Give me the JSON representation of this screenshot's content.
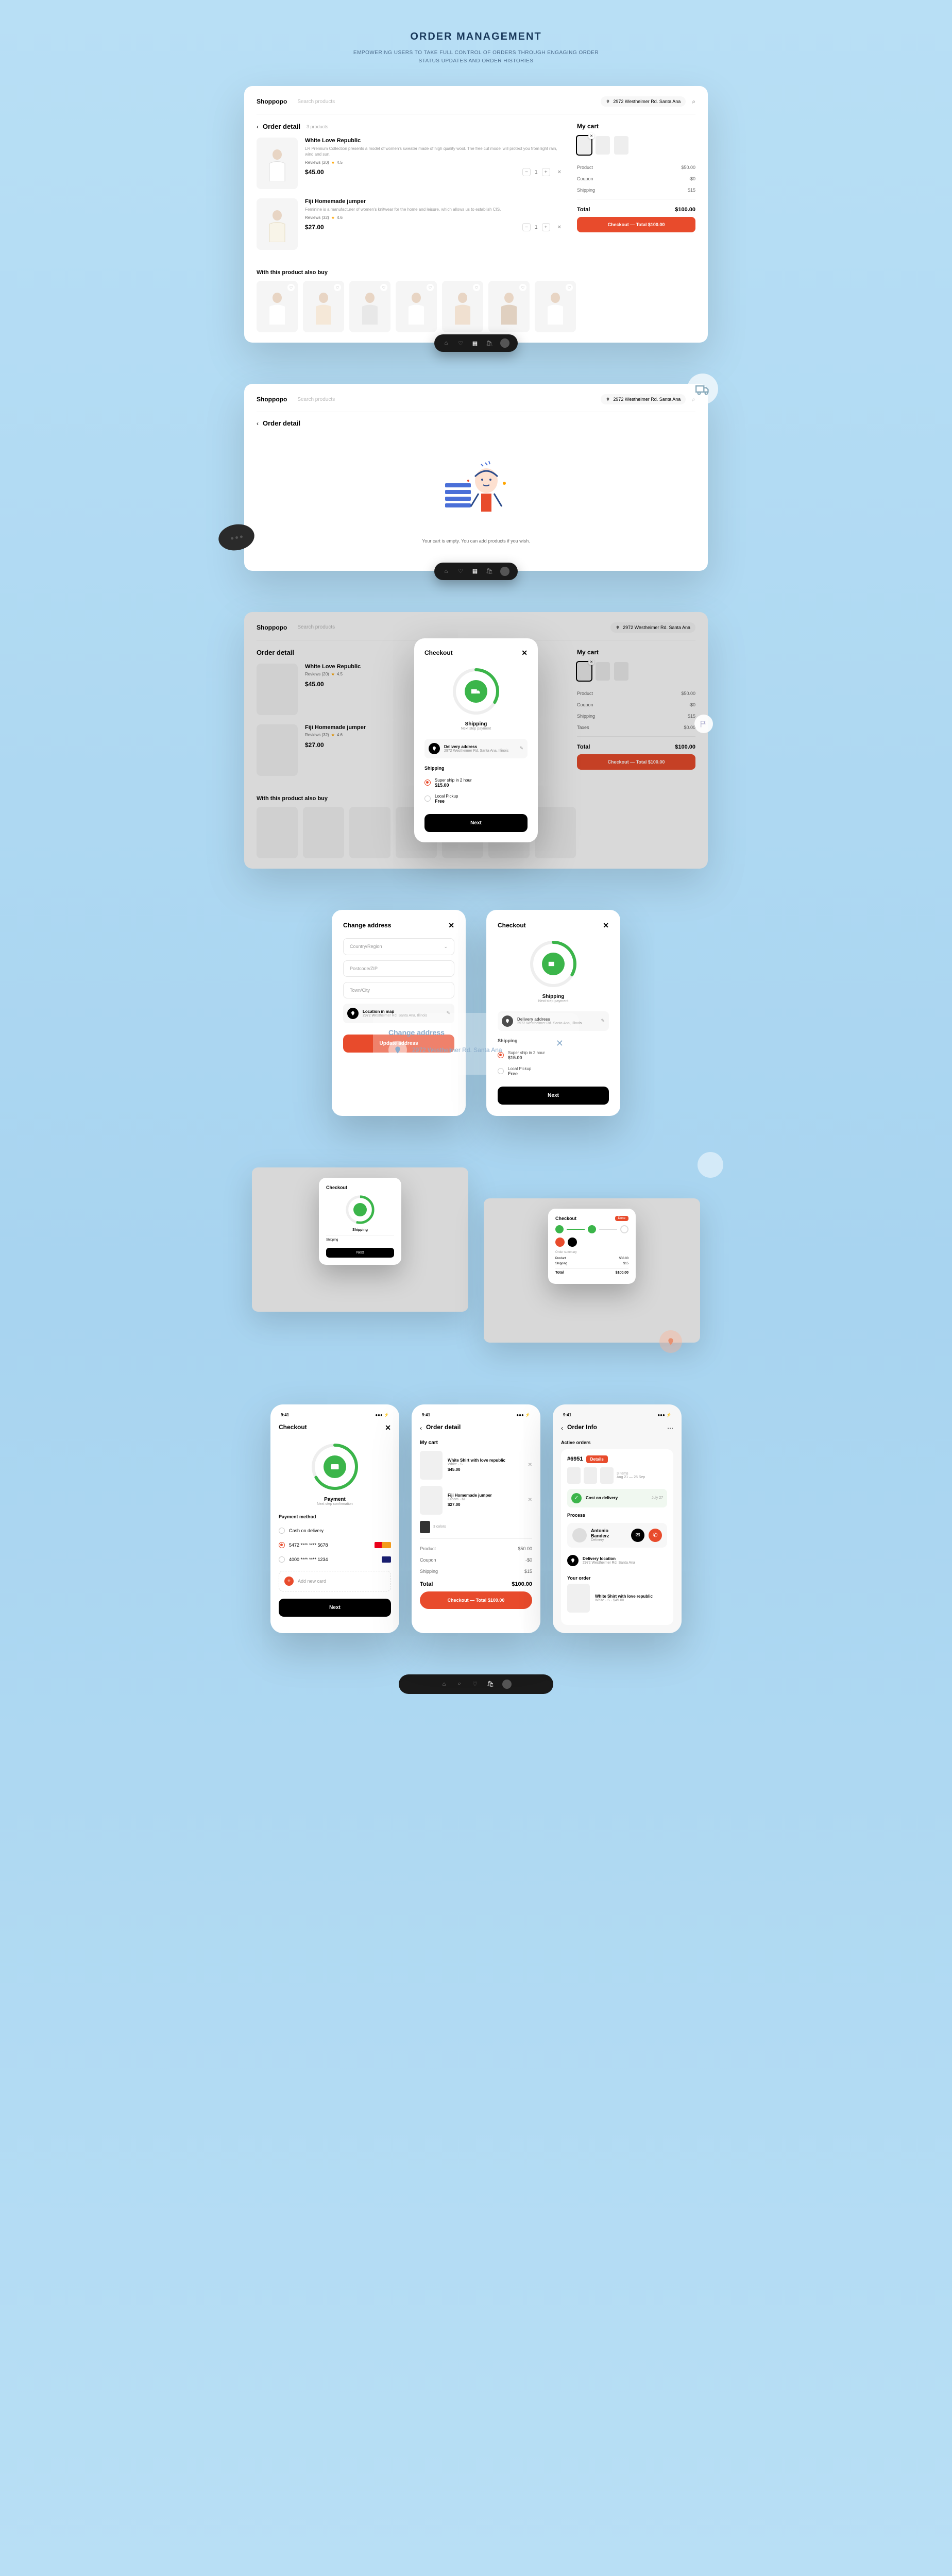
{
  "header": {
    "title": "ORDER MANAGEMENT",
    "subtitle": "EMPOWERING USERS TO TAKE FULL CONTROL OF ORDERS THROUGH ENGAGING ORDER STATUS UPDATES AND ORDER HISTORIES"
  },
  "app": {
    "logo": "Shoppopo",
    "search_placeholder": "Search products",
    "address": "2972 Westheimer Rd. Santa Ana"
  },
  "order_detail": {
    "back": "‹",
    "title": "Order detail",
    "count": "3 products",
    "products": [
      {
        "name": "White Love Republic",
        "desc": "LR Premium Collection presents a model of women's sweater made of high quality wool. The free cut model will protect you from light rain, wind and sun.",
        "reviews": "Reviews (20)",
        "rating": "4.5",
        "price": "$45.00",
        "qty": "1"
      },
      {
        "name": "Fiji Homemade jumper",
        "desc": "Feminine is a manufacturer of women's knitwear for the home and leisure, which allows us to establish CIS.",
        "reviews": "Reviews (32)",
        "rating": "4.6",
        "price": "$27.00",
        "qty": "1"
      }
    ]
  },
  "cart": {
    "title": "My cart",
    "lines": {
      "product_l": "Product",
      "product_v": "$50.00",
      "coupon_l": "Coupon",
      "coupon_v": "-$0",
      "shipping_l": "Shipping",
      "shipping_v": "$15",
      "taxes_l": "Taxes",
      "taxes_v": "$0.00",
      "total_l": "Total",
      "total_v": "$100.00"
    },
    "checkout": "Checkout — Total $100.00"
  },
  "also_buy": {
    "title": "With this product also buy"
  },
  "empty": {
    "text": "Your cart is empty. You can add products if you wish."
  },
  "checkout_modal": {
    "title": "Checkout",
    "step": "Shipping",
    "step_sub": "Next step payment",
    "addr_label": "Delivery address",
    "addr_value": "2972 Westheimer Rd. Santa Ana, Illinois",
    "shipping_title": "Shipping",
    "opt1_label": "Super ship in 2 hour",
    "opt1_price": "$15.00",
    "opt2_label": "Local Pickup",
    "opt2_price": "Free",
    "next": "Next"
  },
  "change_addr": {
    "title": "Change address",
    "country": "Country/Region",
    "postcode": "Postcode/ZIP",
    "town": "Town/City",
    "loc_label": "Location in map",
    "loc_value": "2972 Westheimer Rd. Santa Ana, Illinois",
    "update": "Update address"
  },
  "bg_addr": {
    "title": "Change address",
    "value": "2972 Westheimer Rd. Santa Ana"
  },
  "payment": {
    "title": "Checkout",
    "step": "Payment",
    "step_sub": "Next step confirmation",
    "method_title": "Payment method",
    "cod": "Cash on delivery",
    "card1": "5472 **** **** 5678",
    "card2": "4000 **** **** 1234",
    "add_card": "Add new card",
    "next": "Next"
  },
  "mobile_order": {
    "title": "Order detail",
    "cart_title": "My cart",
    "items": [
      {
        "name": "White Shirt with love republic",
        "meta": "White · S",
        "price": "$45.00"
      },
      {
        "name": "Fiji Homemade jumper",
        "meta": "Cream · M",
        "price": "$27.00"
      }
    ],
    "swatch_label": "3 colors",
    "product_l": "Product",
    "product_v": "$50.00",
    "coupon_l": "Coupon",
    "coupon_v": "-$0",
    "shipping_l": "Shipping",
    "shipping_v": "$15",
    "total_l": "Total",
    "total_v": "$100.00",
    "checkout": "Checkout — Total $100.00"
  },
  "order_info": {
    "title": "Order Info",
    "tab": "Active orders",
    "id": "#6951",
    "view": "Details",
    "item_count": "3 items",
    "date": "Aug 21 — 25 Sep",
    "status": "Cost on delivery",
    "status_date": "July 27",
    "process": "Process",
    "courier_name": "Antonio Banderz",
    "courier_role": "Delivery",
    "loc_label": "Delivery location",
    "loc_val": "2972 Westheimer Rd. Santa Ana",
    "your_order": "Your order",
    "order_item": "White Shirt with love republic",
    "order_item_meta": "White · S · $45.00"
  },
  "time": "9:41"
}
